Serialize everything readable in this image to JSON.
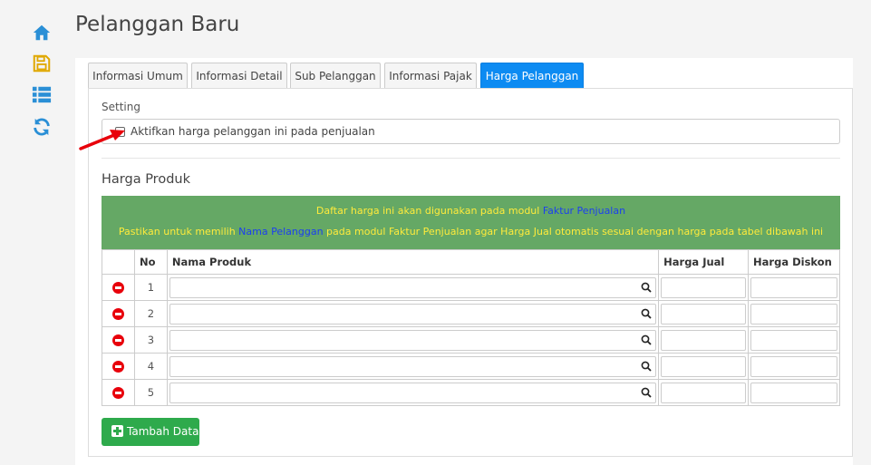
{
  "sidebar": {
    "icons": [
      "home-icon",
      "save-icon",
      "list-icon",
      "refresh-icon"
    ],
    "accent": "#2a8fd6",
    "save_color": "#e0a800"
  },
  "page": {
    "title": "Pelanggan Baru"
  },
  "tabs": [
    {
      "label": "Informasi Umum",
      "active": false
    },
    {
      "label": "Informasi Detail",
      "active": false
    },
    {
      "label": "Sub Pelanggan",
      "active": false
    },
    {
      "label": "Informasi Pajak",
      "active": false
    },
    {
      "label": "Harga Pelanggan",
      "active": true
    }
  ],
  "setting": {
    "label": "Setting",
    "checkbox_label": "Aktifkan harga pelanggan ini pada penjualan",
    "checked": false
  },
  "harga_produk": {
    "title": "Harga Produk",
    "notice": {
      "line1_pre": "Daftar harga ini akan digunakan pada modul ",
      "line1_link": "Faktur Penjualan",
      "line2_pre": "Pastikan untuk memilih ",
      "line2_link": "Nama Pelanggan",
      "line2_post": " pada modul Faktur Penjualan agar Harga Jual otomatis sesuai dengan harga pada tabel dibawah ini",
      "bg_color": "#65a865",
      "text_color": "#ffeb3b",
      "link_color": "#1b3ff0"
    },
    "columns": {
      "no": "No",
      "product": "Nama Produk",
      "price": "Harga Jual",
      "discount": "Harga Diskon"
    },
    "rows": [
      {
        "no": "1",
        "product": "",
        "price": "",
        "discount": ""
      },
      {
        "no": "2",
        "product": "",
        "price": "",
        "discount": ""
      },
      {
        "no": "3",
        "product": "",
        "price": "",
        "discount": ""
      },
      {
        "no": "4",
        "product": "",
        "price": "",
        "discount": ""
      },
      {
        "no": "5",
        "product": "",
        "price": "",
        "discount": ""
      }
    ],
    "add_button": "Tambah Data",
    "add_button_color": "#2eaa4c"
  },
  "active_tab_color": "#0d8bf2",
  "remove_icon_color": "#e8000b"
}
